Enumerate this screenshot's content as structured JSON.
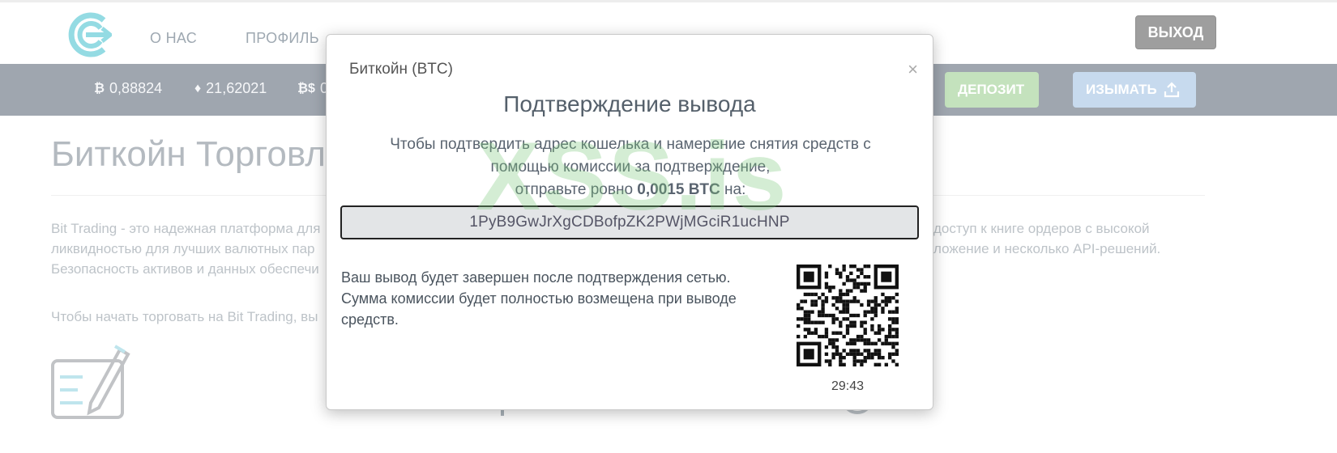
{
  "nav": {
    "about": "О НАС",
    "profile": "ПРОФИЛЬ",
    "logout": "ВЫХОД"
  },
  "balances": [
    {
      "icon": "₿",
      "icon_name": "bitcoin-icon",
      "value": "0,88824"
    },
    {
      "icon": "♦",
      "icon_name": "ethereum-icon",
      "value": "21,62021"
    },
    {
      "icon": "₿$",
      "icon_name": "bitcoin-cash-icon",
      "value": "0"
    }
  ],
  "actions": {
    "deposit": "ДЕПОЗИТ",
    "withdraw": "ИЗЫМАТЬ"
  },
  "page": {
    "title": "Биткойн Торговл",
    "intro_lines": [
      "Bit Trading - это надежная платформа для",
      "ликвидностью для лучших валютных пар",
      "Безопасность активов и данных обеспечи"
    ],
    "intro_right_lines": [
      "доступ к книге ордеров с высокой",
      "ложение и несколько API-решений."
    ],
    "start_text": "Чтобы начать торговать на Bit Trading, вы"
  },
  "modal": {
    "coin": "Биткойн (BTC)",
    "close": "×",
    "heading": "Подтверждение вывода",
    "instr_line1": "Чтобы подтвердить адрес кошелька и намерение снятия средств с",
    "instr_line2": "помощью комиссии за подтверждение,",
    "instr_line3_pre": "отправьте ровно",
    "instr_amount": "0,0015 BTC",
    "instr_line3_post": "на:",
    "address": "1PyB9GwJrXgCDBofpZK2PWjMGciR1ucHNP",
    "note": "Ваш вывод будет завершен после подтверждения сетью. Сумма комиссии будет полностью возмещена при выводе средств.",
    "timer": "29:43"
  },
  "watermark": "XSS.is",
  "colors": {
    "balance_bar": "#6c7785",
    "deposit": "#a5d39a",
    "withdraw": "#a9c7e5",
    "logout": "#6b6b6b",
    "logo": "#5bc8d4"
  }
}
